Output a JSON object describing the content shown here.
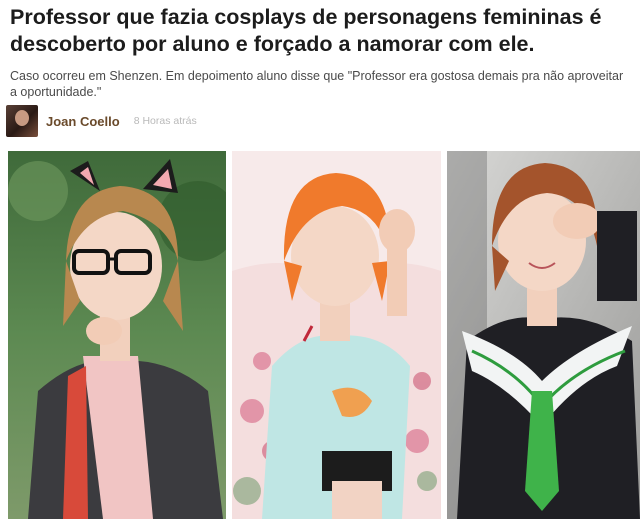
{
  "article": {
    "headline": "Professor que fazia cosplays de personagens femininas é descoberto por aluno e forçado a namorar com ele.",
    "summary": "Caso ocorreu em Shenzen. Em depoimento aluno disse que \"Professor era gostosa demais pra não aproveitar a oportunidade.\""
  },
  "byline": {
    "author": "Joan Coello",
    "time": "8 Horas atrás"
  },
  "photos": [
    {
      "name": "cosplayer-with-cat-ears-and-glasses"
    },
    {
      "name": "cosplayer-with-orange-wig"
    },
    {
      "name": "cosplayer-in-sailor-uniform"
    }
  ]
}
